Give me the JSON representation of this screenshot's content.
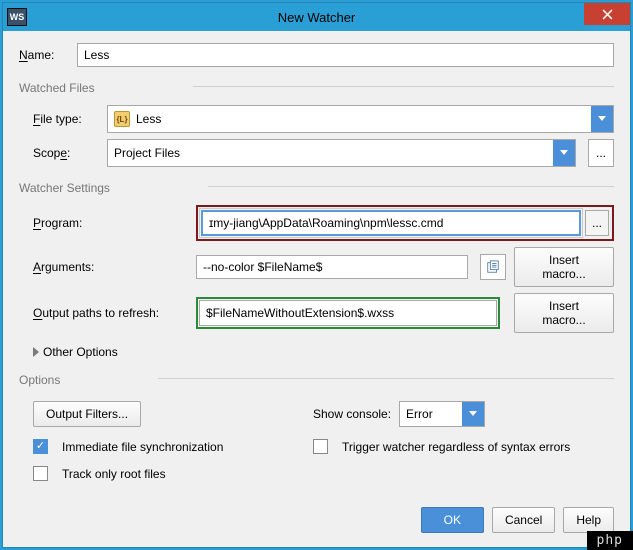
{
  "titlebar": {
    "app_icon": "WS",
    "title": "New Watcher"
  },
  "name": {
    "label": "Name:",
    "value": "Less"
  },
  "watched_files": {
    "section": "Watched Files",
    "filetype_label": "File type:",
    "filetype_value": "Less",
    "scope_label": "Scope:",
    "scope_value": "Project Files"
  },
  "watcher_settings": {
    "section": "Watcher Settings",
    "program_label": "Program:",
    "program_value": "ɪmy-jiang\\AppData\\Roaming\\npm\\lessc.cmd",
    "arguments_label": "Arguments:",
    "arguments_value": "--no-color $FileName$",
    "output_label": "Output paths to refresh:",
    "output_value": "$FileNameWithoutExtension$.wxss",
    "insert_macro": "Insert macro...",
    "other_options": "Other Options"
  },
  "options": {
    "section": "Options",
    "output_filters": "Output Filters...",
    "show_console_label": "Show console:",
    "show_console_value": "Error",
    "immediate_sync": "Immediate file synchronization",
    "trigger_watcher": "Trigger watcher regardless of syntax errors",
    "track_root": "Track only root files"
  },
  "buttons": {
    "ok": "OK",
    "cancel": "Cancel",
    "help": "Help",
    "ellipsis": "..."
  },
  "watermark": "php"
}
